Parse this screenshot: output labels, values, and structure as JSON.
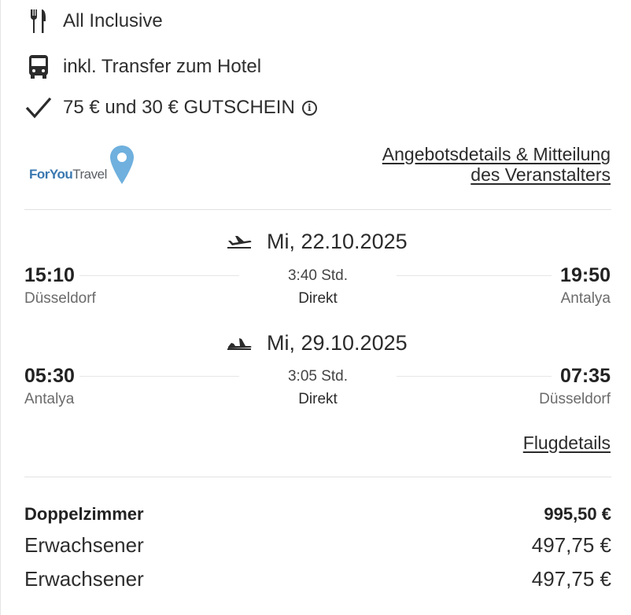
{
  "features": [
    {
      "icon": "cutlery-icon",
      "label": "All Inclusive"
    },
    {
      "icon": "bus-icon",
      "label": "inkl. Transfer zum Hotel"
    },
    {
      "icon": "checkmark-icon",
      "label": "75 € und 30 € GUTSCHEIN",
      "info_icon": "info-icon"
    }
  ],
  "operator": {
    "logo_text_1": "For",
    "logo_text_2": "You",
    "logo_text_3": "Travel",
    "details_link_line1": "Angebotsdetails & Mitteilung",
    "details_link_line2": "des Veranstalters"
  },
  "outbound": {
    "icon": "plane-departure-icon",
    "date": "Mi, 22.10.2025",
    "dep_time": "15:10",
    "dep_city": "Düsseldorf",
    "duration": "3:40 Std.",
    "type": "Direkt",
    "arr_time": "19:50",
    "arr_city": "Antalya"
  },
  "inbound": {
    "icon": "plane-arrival-icon",
    "date": "Mi, 29.10.2025",
    "dep_time": "05:30",
    "dep_city": "Antalya",
    "duration": "3:05 Std.",
    "type": "Direkt",
    "arr_time": "07:35",
    "arr_city": "Düsseldorf"
  },
  "flight_details_link": "Flugdetails",
  "pricing": {
    "room_label": "Doppelzimmer",
    "room_total": "995,50 €",
    "persons": [
      {
        "label": "Erwachsener",
        "price": "497,75 €"
      },
      {
        "label": "Erwachsener",
        "price": "497,75 €"
      }
    ]
  },
  "colors": {
    "logo_blue": "#3a78b0",
    "pin_blue": "#6fb0de",
    "text": "#2b2b2b"
  }
}
